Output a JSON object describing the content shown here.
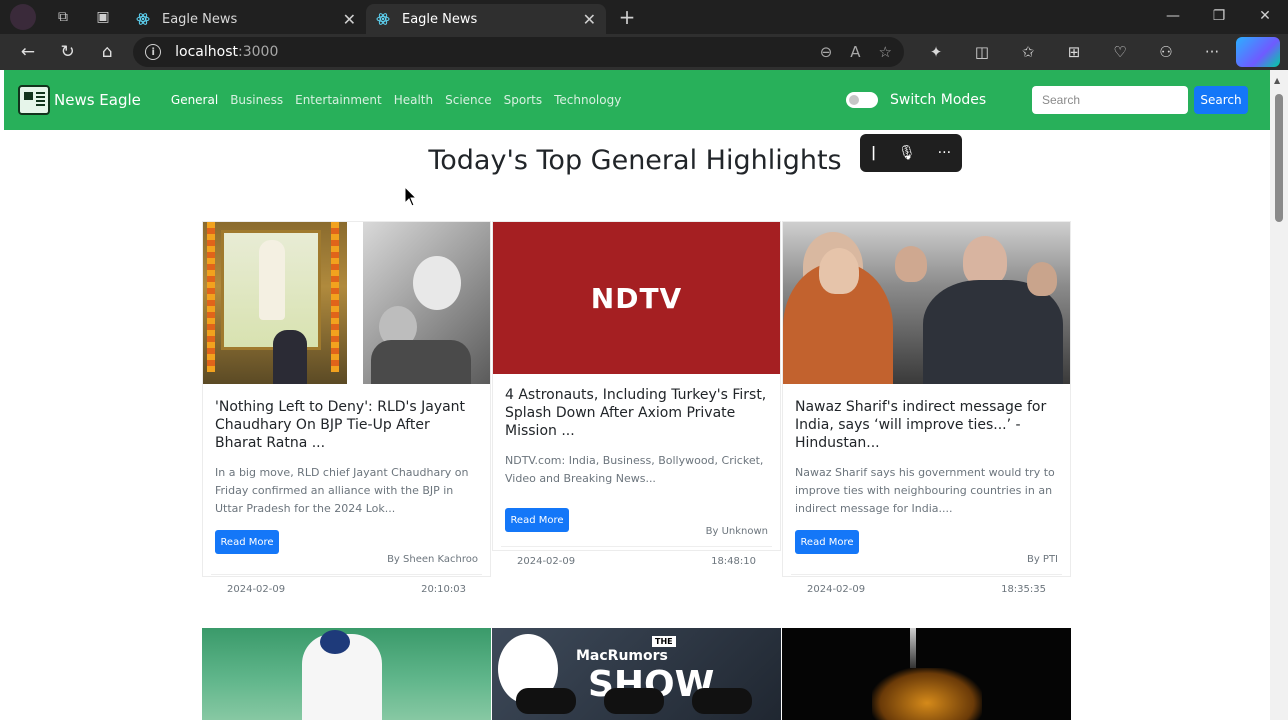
{
  "browser": {
    "tabs": [
      {
        "title": "Eagle News",
        "active": false
      },
      {
        "title": "Eagle News",
        "active": true
      }
    ],
    "url_host": "localhost",
    "url_port": ":3000"
  },
  "navbar": {
    "brand": "News Eagle",
    "links": [
      "General",
      "Business",
      "Entertainment",
      "Health",
      "Science",
      "Sports",
      "Technology"
    ],
    "active_link": "General",
    "switch_label": "Switch Modes",
    "search_placeholder": "Search",
    "search_button": "Search"
  },
  "heading": "Today's Top General Highlights",
  "cards": [
    {
      "title": "'Nothing Left to Deny': RLD's Jayant Chaudhary On BJP Tie-Up After Bharat Ratna ...",
      "description": "In a big move, RLD chief Jayant Chaudhary on Friday confirmed an alliance with the BJP in Uttar Pradesh for the 2024 Lok...",
      "read_more": "Read More",
      "author": "By Sheen Kachroo",
      "date": "2024-02-09",
      "time": "20:10:03"
    },
    {
      "title": "4 Astronauts, Including Turkey's First, Splash Down After Axiom Private Mission ...",
      "description": "NDTV.com: India, Business, Bollywood, Cricket, Video and Breaking News...",
      "read_more": "Read More",
      "author": "By Unknown",
      "date": "2024-02-09",
      "time": "18:48:10",
      "image_text": "NDTV"
    },
    {
      "title": "Nawaz Sharif's indirect message for India, says ‘will improve ties...’ - Hindustan...",
      "description": "Nawaz Sharif says his government would try to improve ties with neighbouring countries in an indirect message for India....",
      "read_more": "Read More",
      "author": "By PTI",
      "date": "2024-02-09",
      "time": "18:35:35"
    }
  ],
  "bottom_cards": {
    "macrumors_the": "THE",
    "macrumors_text": "MacRumors",
    "macrumors_big": "SHOW"
  },
  "colors": {
    "navbar": "#28b05a",
    "primary_button": "#1477f8",
    "ndtv_red": "#a51f22"
  }
}
